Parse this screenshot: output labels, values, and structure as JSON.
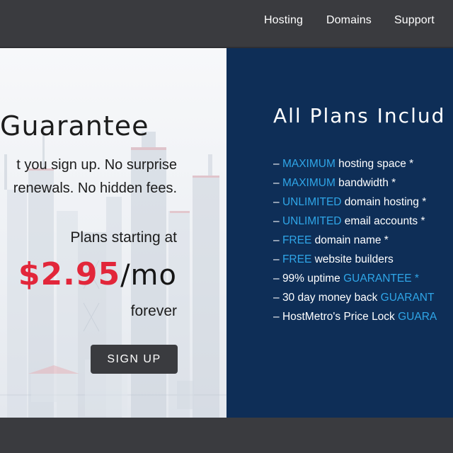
{
  "nav": {
    "items": [
      {
        "label": "Hosting"
      },
      {
        "label": "Domains"
      },
      {
        "label": "Support"
      }
    ]
  },
  "hero": {
    "heading": "Guarantee",
    "line1": "t you sign up. No surprise",
    "line2": "renewals. No hidden fees.",
    "starting": "Plans starting at",
    "price": "$2.95",
    "per": "/mo",
    "forever": "forever",
    "signup_label": "SIGN UP"
  },
  "plans": {
    "title": "All Plans Includ",
    "features": [
      {
        "prefix": "– ",
        "highlight": "MAXIMUM",
        "text": " hosting space *",
        "suffix_highlight": ""
      },
      {
        "prefix": "– ",
        "highlight": "MAXIMUM",
        "text": " bandwidth *",
        "suffix_highlight": ""
      },
      {
        "prefix": "– ",
        "highlight": "UNLIMITED",
        "text": " domain hosting *",
        "suffix_highlight": ""
      },
      {
        "prefix": "– ",
        "highlight": "UNLIMITED",
        "text": " email accounts *",
        "suffix_highlight": ""
      },
      {
        "prefix": "– ",
        "highlight": "FREE",
        "text": " domain name *",
        "suffix_highlight": ""
      },
      {
        "prefix": "– ",
        "highlight": "FREE",
        "text": " website builders",
        "suffix_highlight": ""
      },
      {
        "prefix": "– ",
        "highlight": "",
        "text": "99% uptime ",
        "suffix_highlight": "GUARANTEE *"
      },
      {
        "prefix": "– ",
        "highlight": "",
        "text": "30 day money back ",
        "suffix_highlight": "GUARANT"
      },
      {
        "prefix": "– ",
        "highlight": "",
        "text": "HostMetro's Price Lock ",
        "suffix_highlight": "GUARA"
      }
    ]
  },
  "colors": {
    "topbar": "#3a3b3f",
    "panel_right": "#0e2e57",
    "price_red": "#e2263a",
    "highlight_blue": "#2fa6e8",
    "button": "#3a3b3f"
  }
}
